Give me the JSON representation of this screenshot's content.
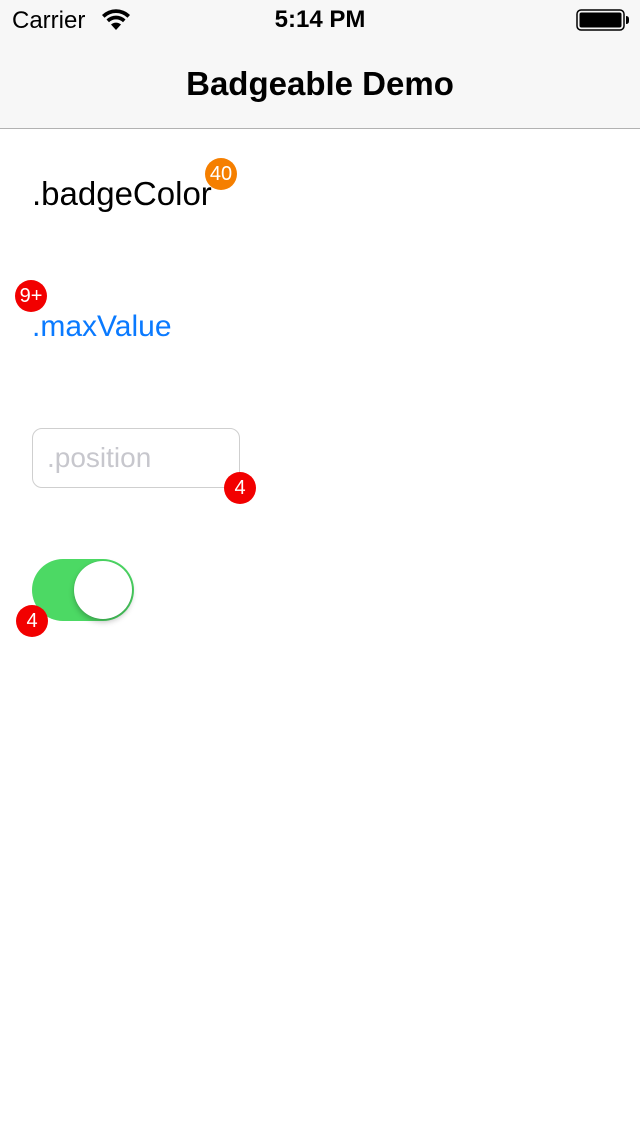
{
  "status_bar": {
    "carrier": "Carrier",
    "time": "5:14 PM",
    "icons": [
      "wifi-icon",
      "battery-icon"
    ]
  },
  "nav": {
    "title": "Badgeable Demo"
  },
  "items": {
    "badge_color_label": ".badgeColor",
    "badge_color_badge": "40",
    "max_value_link": ".maxValue",
    "max_value_badge": "9+",
    "position_field": {
      "value": "",
      "placeholder": ".position"
    },
    "position_badge": "4",
    "switch": {
      "on": true
    },
    "switch_badge": "4"
  },
  "colors": {
    "badge_red": "#f20000",
    "badge_orange": "#f57f00",
    "link_blue": "#0a7aff",
    "switch_on": "#4cd964"
  }
}
